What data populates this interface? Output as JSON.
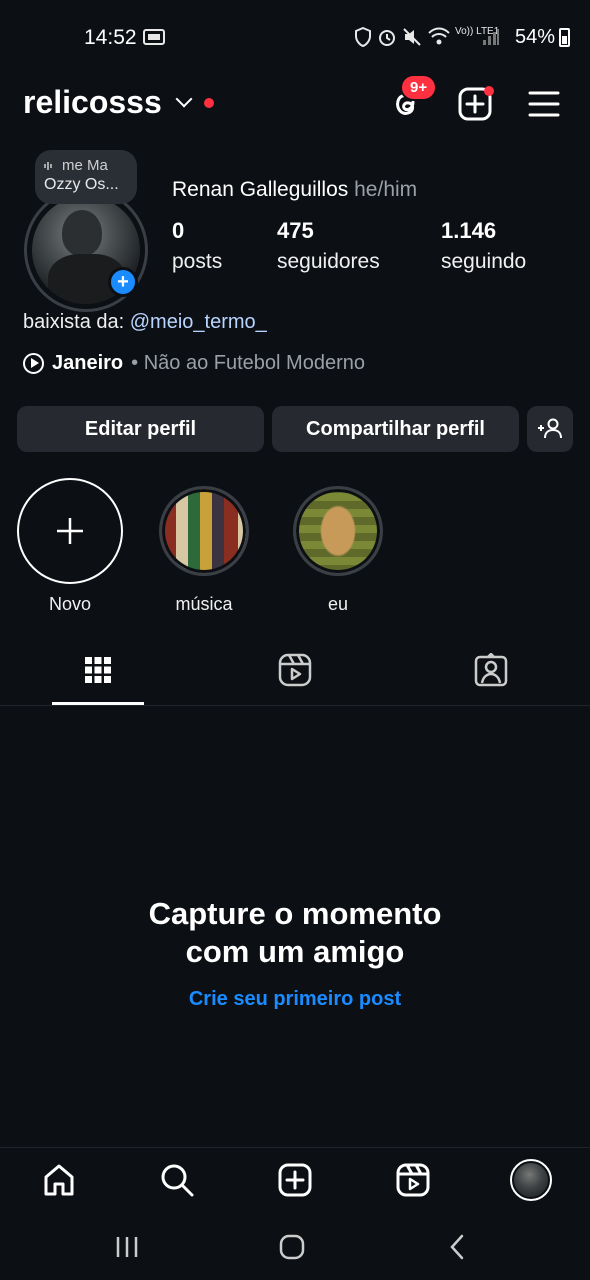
{
  "status_bar": {
    "time": "14:52",
    "battery": "54%",
    "network": "Vo)) LTE1"
  },
  "header": {
    "username": "relicosss",
    "threads_badge": "9+"
  },
  "profile": {
    "note_line1": "me    Ma",
    "note_line2": "Ozzy Os...",
    "full_name": "Renan Galleguillos",
    "pronouns": "he/him",
    "stats": [
      {
        "value": "0",
        "label": "posts"
      },
      {
        "value": "475",
        "label": "seguidores"
      },
      {
        "value": "1.146",
        "label": "seguindo"
      }
    ],
    "bio_prefix": "baixista da: ",
    "bio_mention": "@meio_termo_",
    "song": "Janeiro",
    "song_separator": " • ",
    "artist": "Não ao Futebol Moderno"
  },
  "actions": {
    "edit": "Editar perfil",
    "share": "Compartilhar perfil"
  },
  "highlights": [
    {
      "label": "Novo"
    },
    {
      "label": "música"
    },
    {
      "label": "eu"
    }
  ],
  "empty_state": {
    "title_line1": "Capture o momento",
    "title_line2": "com um amigo",
    "cta": "Crie seu primeiro post"
  },
  "colors": {
    "background": "#0c0f14",
    "accent": "#1a8cff",
    "badge": "#ff3040"
  }
}
